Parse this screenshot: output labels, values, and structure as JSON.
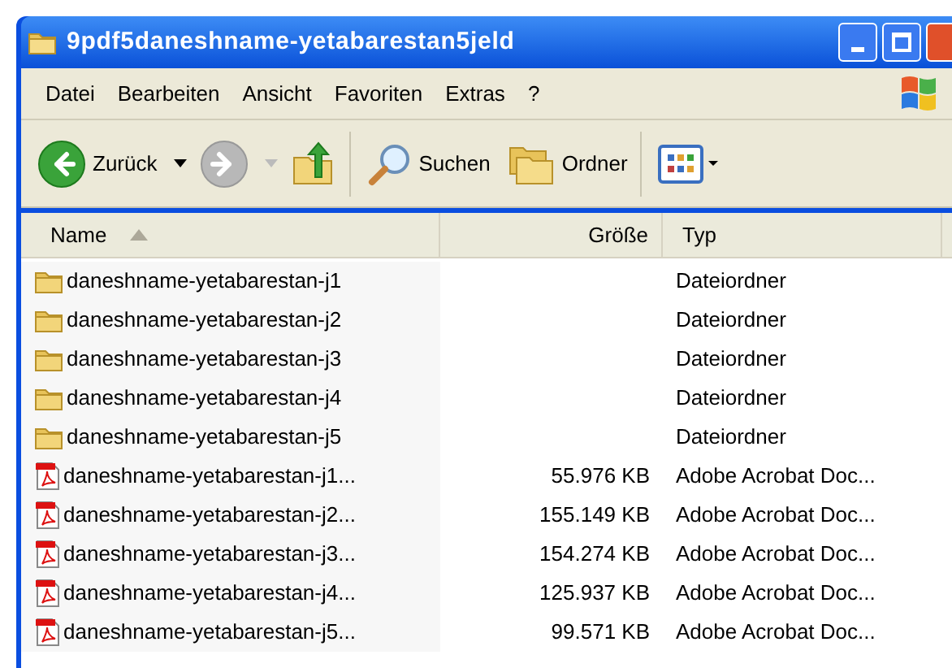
{
  "window": {
    "title": "9pdf5daneshname-yetabarestan5jeld"
  },
  "menu": [
    "Datei",
    "Bearbeiten",
    "Ansicht",
    "Favoriten",
    "Extras",
    "?"
  ],
  "toolbar": [
    {
      "kind": "back",
      "label": "Zurück",
      "disabled": false
    },
    {
      "kind": "forward",
      "disabled": true
    },
    {
      "kind": "up",
      "disabled": false
    },
    {
      "kind": "search",
      "label": "Suchen",
      "disabled": false
    },
    {
      "kind": "folders",
      "label": "Ordner",
      "disabled": false
    },
    {
      "kind": "views",
      "disabled": false
    }
  ],
  "table": {
    "columns": [
      {
        "label": "Name",
        "sorted": true
      },
      {
        "label": "Größe",
        "sorted": false
      },
      {
        "label": "Typ",
        "sorted": false
      }
    ],
    "rows": [
      {
        "kind": "folder",
        "name": "daneshname-yetabarestan-j1",
        "type": "Dateiordner"
      },
      {
        "kind": "folder",
        "name": "daneshname-yetabarestan-j2",
        "type": "Dateiordner"
      },
      {
        "kind": "folder",
        "name": "daneshname-yetabarestan-j3",
        "type": "Dateiordner"
      },
      {
        "kind": "folder",
        "name": "daneshname-yetabarestan-j4",
        "type": "Dateiordner"
      },
      {
        "kind": "folder",
        "name": "daneshname-yetabarestan-j5",
        "type": "Dateiordner"
      },
      {
        "kind": "pdf",
        "name": "daneshname-yetabarestan-j1...",
        "size": "55.976 KB",
        "type": "Adobe Acrobat Doc..."
      },
      {
        "kind": "pdf",
        "name": "daneshname-yetabarestan-j2...",
        "size": "155.149 KB",
        "type": "Adobe Acrobat Doc..."
      },
      {
        "kind": "pdf",
        "name": "daneshname-yetabarestan-j3...",
        "size": "154.274 KB",
        "type": "Adobe Acrobat Doc..."
      },
      {
        "kind": "pdf",
        "name": "daneshname-yetabarestan-j4...",
        "size": "125.937 KB",
        "type": "Adobe Acrobat Doc..."
      },
      {
        "kind": "pdf",
        "name": "daneshname-yetabarestan-j5...",
        "size": "99.571 KB",
        "type": "Adobe Acrobat Doc..."
      }
    ]
  }
}
